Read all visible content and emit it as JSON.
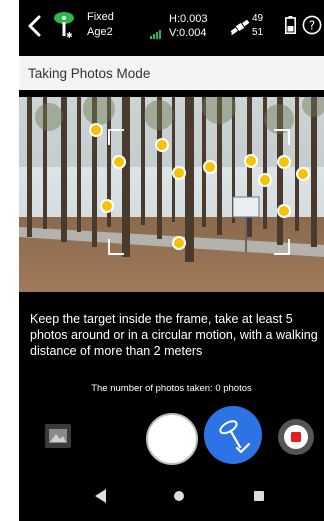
{
  "status": {
    "fix_status": "Fixed",
    "fix_sub": "Age2",
    "h_precision": "H:0.003",
    "v_precision": "V:0.004",
    "sat_count_top": "49",
    "sat_count_bottom": "51"
  },
  "header": {
    "title": "Taking Photos Mode"
  },
  "main": {
    "instructions": "Keep the target inside the frame, take at least 5 photos around or in a circular motion, with a walking distance of more than 2 meters",
    "photo_count_text": "The number of photos taken: 0 photos"
  },
  "icons": {
    "back": "back-arrow-icon",
    "gnss": "gnss-receiver-icon",
    "signal": "signal-strength-icon",
    "satellite": "satellite-icon",
    "battery": "battery-icon",
    "help": "help-icon",
    "gallery": "gallery-icon",
    "target": "survey-pole-target-icon",
    "record": "record-stop-icon"
  },
  "colors": {
    "accent_blue": "#2e73e6",
    "marker_yellow": "#f5c400",
    "record_red": "#e01f1f",
    "signal_green": "#2db84a"
  }
}
